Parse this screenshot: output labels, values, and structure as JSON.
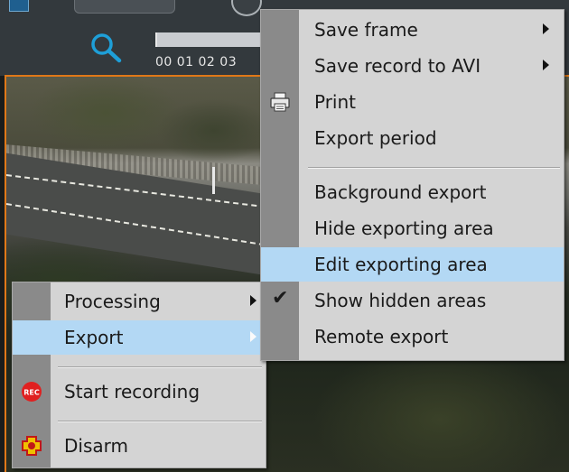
{
  "timeline": {
    "labels": "00 01 02 03"
  },
  "icons": {
    "search": "search-icon",
    "print": "printer-icon",
    "check": "checkmark-icon",
    "rec": "record-icon",
    "disarm": "disarm-icon"
  },
  "colors": {
    "highlight": "#b3d8f4",
    "menu_bg": "#d4d4d4",
    "gutter": "#8a8a8a",
    "accent_border": "#e07818",
    "search_icon": "#1e9fd8",
    "rec_icon": "#e02020"
  },
  "main_menu": {
    "items": [
      {
        "label": "Processing",
        "has_submenu": true
      },
      {
        "label": "Export",
        "has_submenu": true,
        "highlighted": true
      },
      {
        "label": "Start recording",
        "icon": "record-icon"
      },
      {
        "label": "Disarm",
        "icon": "disarm-icon"
      }
    ]
  },
  "export_menu": {
    "items": [
      {
        "label": "Save frame",
        "has_submenu": true
      },
      {
        "label": "Save record to AVI",
        "has_submenu": true
      },
      {
        "label": "Print",
        "icon": "printer-icon"
      },
      {
        "label": "Export period"
      },
      {
        "label": "Background export"
      },
      {
        "label": "Hide exporting area"
      },
      {
        "label": "Edit exporting area",
        "highlighted": true
      },
      {
        "label": "Show hidden areas",
        "checked": true
      },
      {
        "label": "Remote export"
      }
    ]
  }
}
